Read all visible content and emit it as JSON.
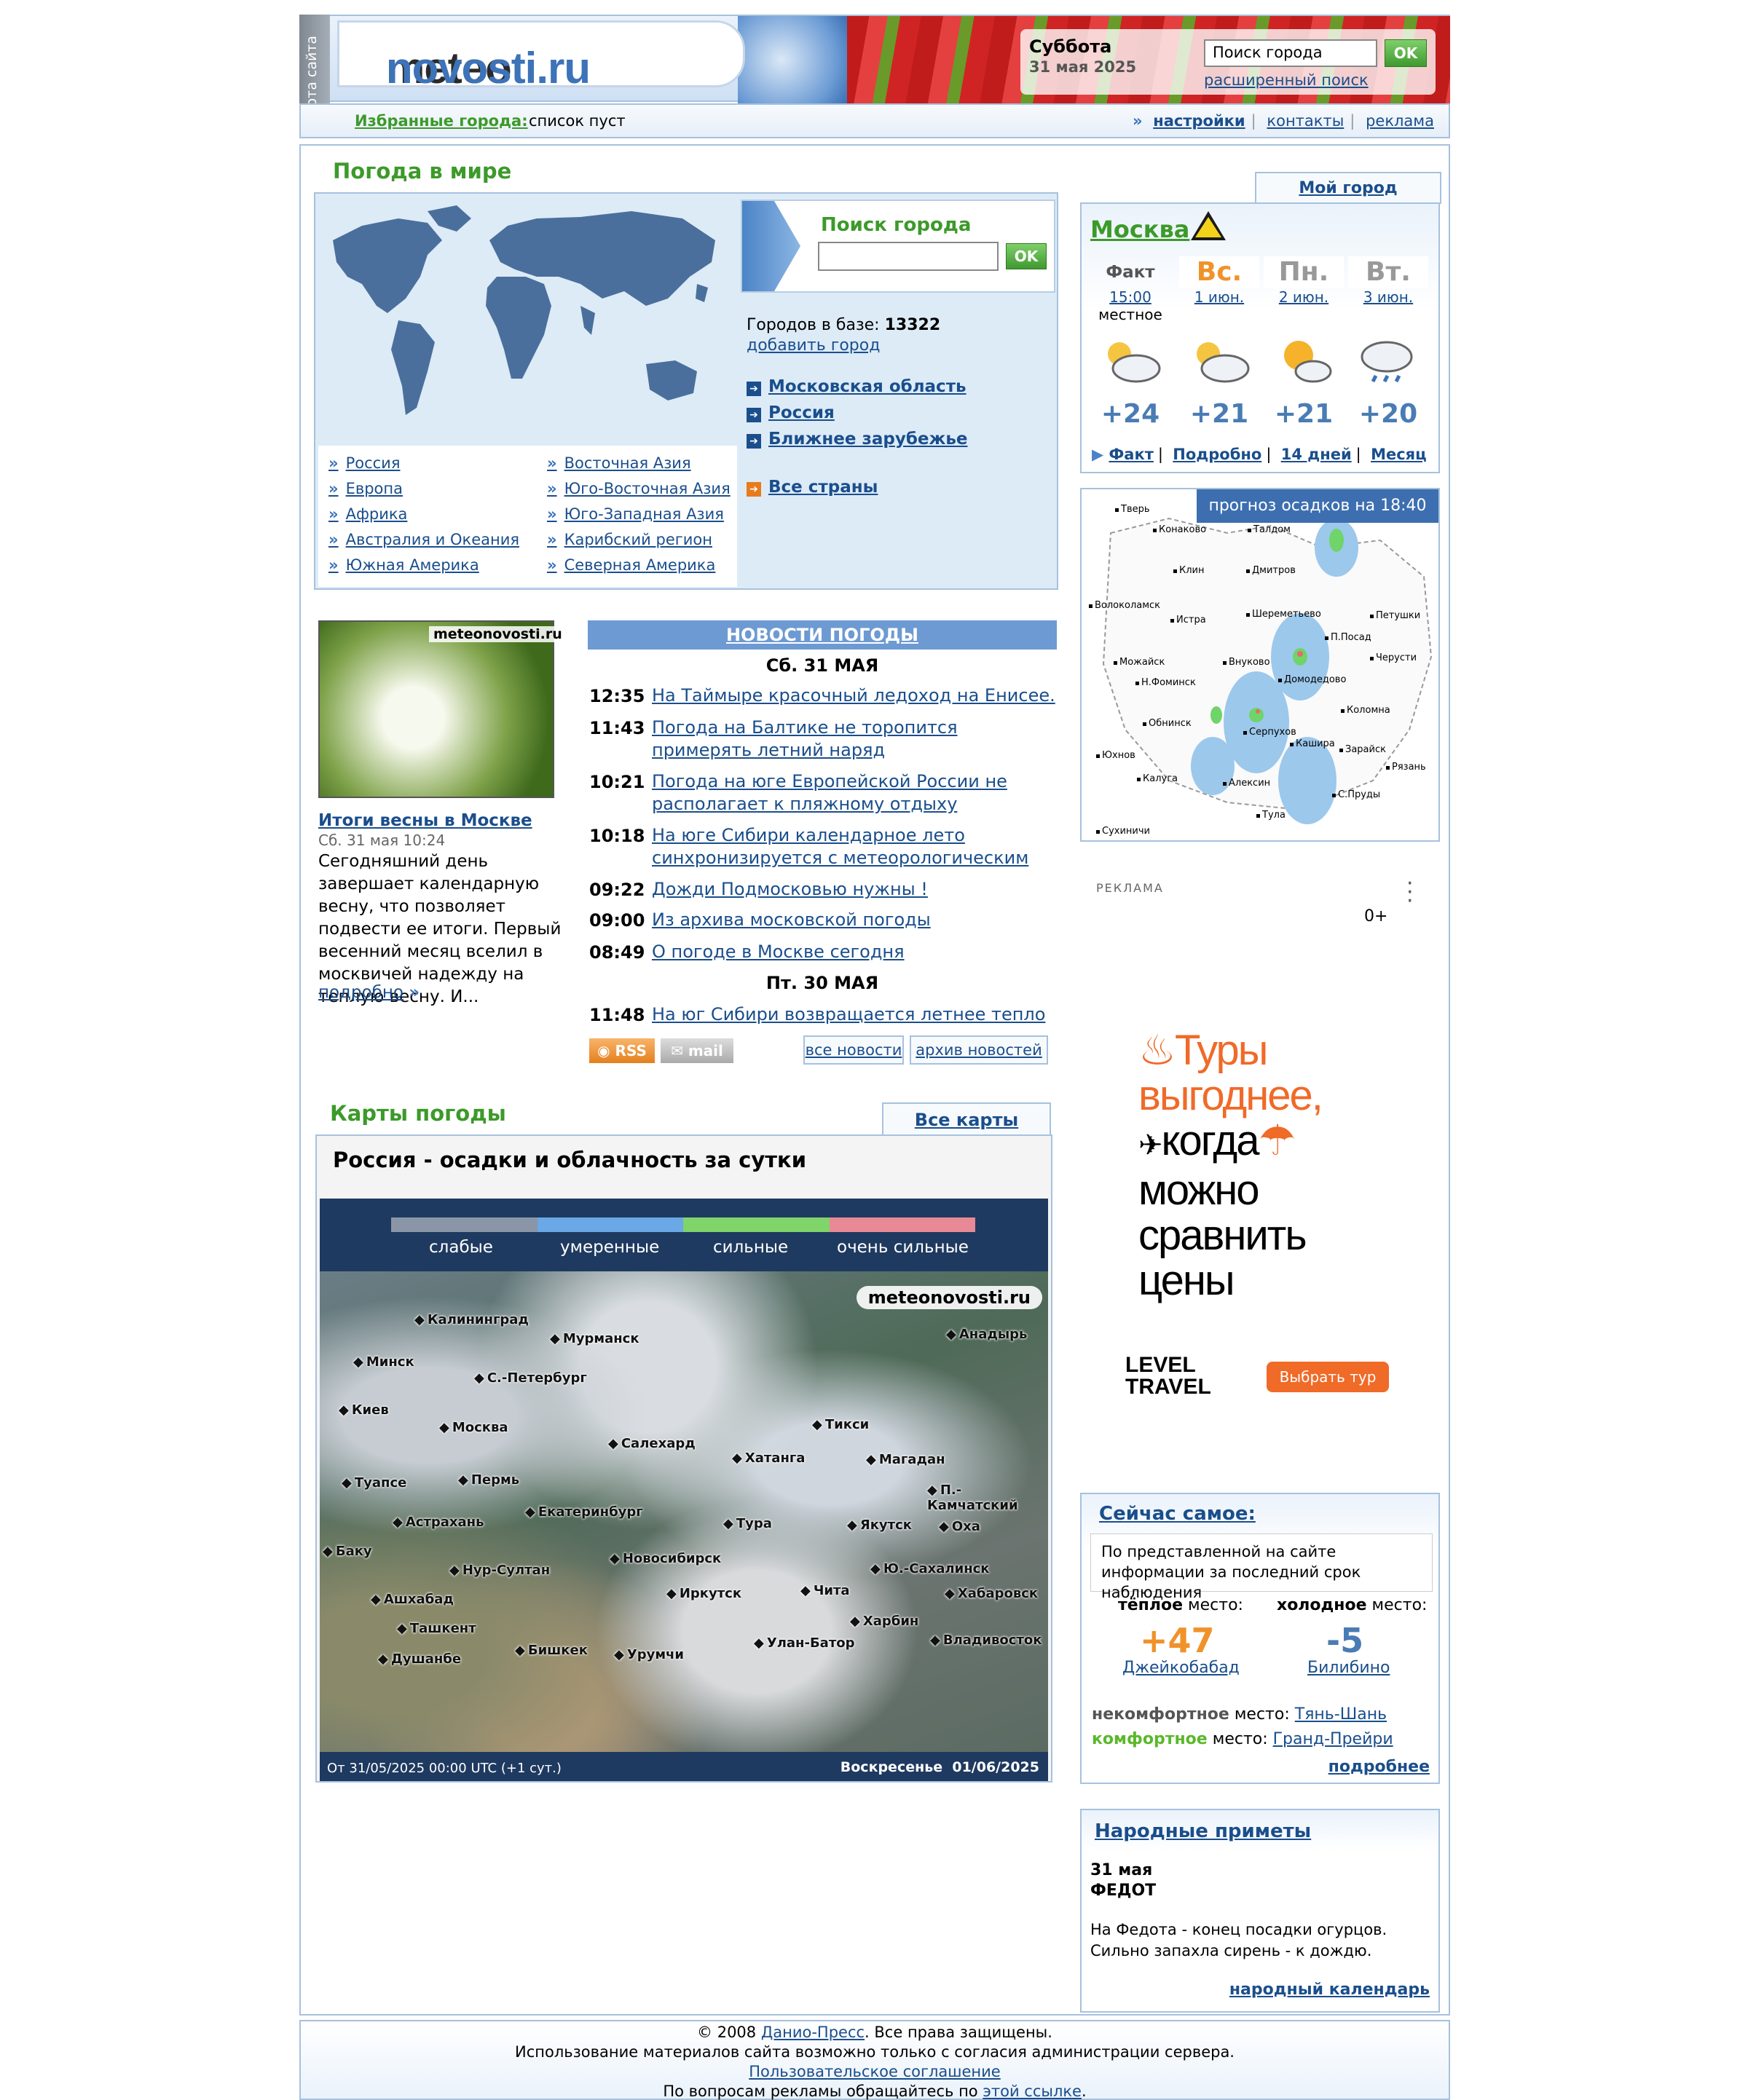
{
  "header": {
    "side_tab": "карта сайта",
    "logo_part1": "meteo",
    "logo_part2": "novosti.ru",
    "day": "Суббота",
    "date": "31 мая 2025",
    "search_value": "Поиск города",
    "search_ok": "OK",
    "advanced_search": "расширенный поиск"
  },
  "favbar": {
    "label": "Избранные города:",
    "value": "список пуст",
    "links": [
      "настройки",
      "контакты",
      "реклама"
    ]
  },
  "world": {
    "title": "Погода в мире",
    "regions_left": [
      "Россия",
      "Европа",
      "Африка",
      "Австралия и Океания",
      "Южная Америка"
    ],
    "regions_right": [
      "Восточная Азия",
      "Юго-Восточная Азия",
      "Юго-Западная Азия",
      "Карибский регион",
      "Северная Америка"
    ],
    "search_title": "Поиск города",
    "search_ok": "OK",
    "cities_label": "Городов в базе:",
    "cities_count": "13322",
    "add_city": "добавить город",
    "links": [
      "Московская область",
      "Россия",
      "Ближнее зарубежье"
    ],
    "all_countries": "Все страны"
  },
  "mycity": {
    "tab": "Мой город",
    "name": "Москва",
    "fact_label": "Факт",
    "fact_time": "15:00",
    "fact_note": "местное",
    "days": [
      {
        "name": "Вс.",
        "date": "1 июн."
      },
      {
        "name": "Пн.",
        "date": "2 июн."
      },
      {
        "name": "Вт.",
        "date": "3 июн."
      }
    ],
    "icons": [
      "partly-cloudy-icon",
      "partly-cloudy-icon",
      "sun-cloud-icon",
      "rain-cloud-icon"
    ],
    "temps": [
      "+24",
      "+21",
      "+21",
      "+20"
    ],
    "links": [
      "Факт",
      "Подробно",
      "14 дней",
      "Месяц"
    ]
  },
  "radar": {
    "title": "прогноз осадков на 18:40",
    "cities": [
      "Тверь",
      "Конаково",
      "Талдом",
      "Клин",
      "Дмитров",
      "Волоколамск",
      "Истра",
      "Шереметьево",
      "Петушки",
      "П.Посад",
      "Можайск",
      "Внуково",
      "Черусти",
      "Н.Фоминск",
      "Домодедово",
      "Обнинск",
      "Коломна",
      "Серпухов",
      "Кашира",
      "Зарайск",
      "Юхнов",
      "Калуга",
      "Алексин",
      "Рязань",
      "С.Пруды",
      "Тула",
      "Сухиничи"
    ]
  },
  "news": {
    "featured": {
      "logo": "meteonovosti.ru",
      "title": "Итоги весны в Москве",
      "date": "Сб. 31 мая 10:24",
      "text": "Сегодняшний день завершает календарную весну, что позволяет подвести ее итоги.      Первый весенний месяц вселил в москвичей надежду на теплую весну. И...",
      "more": "подробно"
    },
    "header": "НОВОСТИ ПОГОДЫ",
    "day1": "Сб. 31 МАЯ",
    "items1": [
      {
        "time": "12:35",
        "title": "На Таймыре красочный ледоход на Енисее."
      },
      {
        "time": "11:43",
        "title": "Погода на Балтике не торопится примерять летний наряд"
      },
      {
        "time": "10:21",
        "title": "Погода на юге Европейской России не располагает к пляжному отдыху"
      },
      {
        "time": "10:18",
        "title": "На юге Сибири календарное лето синхронизируется с метеорологическим"
      },
      {
        "time": "09:22",
        "title": "Дожди Подмосковью нужны !"
      },
      {
        "time": "09:00",
        "title": "Из архива московской погоды"
      },
      {
        "time": "08:49",
        "title": "О погоде в Москве сегодня"
      }
    ],
    "day2": "Пт. 30 МАЯ",
    "items2": [
      {
        "time": "11:48",
        "title": "На юг Сибири возвращается летнее тепло"
      }
    ],
    "rss": "RSS",
    "mail": "mail",
    "all_news": "все новости",
    "archive": "архив новостей"
  },
  "maps": {
    "title": "Карты погоды",
    "all_maps": "Все карты",
    "map_title": "Россия - осадки и облачность за сутки",
    "legend": [
      "слабые",
      "умеренные",
      "сильные",
      "очень сильные"
    ],
    "legend_colors": [
      "#8a96a8",
      "#6aa8e6",
      "#7fd46a",
      "#e88a96"
    ],
    "logo": "meteonovosti.ru",
    "cities": [
      "Калининград",
      "Мурманск",
      "Анадырь",
      "Минск",
      "С.-Петербург",
      "Киев",
      "Москва",
      "Тикси",
      "Салехард",
      "Хатанга",
      "Магадан",
      "Туапсе",
      "Пермь",
      "П.-Камчатский",
      "Екатеринбург",
      "Астрахань",
      "Тура",
      "Якутск",
      "Оха",
      "Баку",
      "Новосибирск",
      "Нур-Султан",
      "Ю.-Сахалинск",
      "Ашхабад",
      "Иркутск",
      "Чита",
      "Хабаровск",
      "Ташкент",
      "Харбин",
      "Улан-Батор",
      "Бишкек",
      "Владивосток",
      "Душанбе",
      "Урумчи"
    ],
    "foot_left": "От 31/05/2025 00:00 UTC (+1 сут.)",
    "foot_right": "Воскресенье  01/06/2025"
  },
  "ad": {
    "label": "РЕКЛАМА",
    "age": "0+",
    "line1": "Туры",
    "line2": "выгоднее,",
    "line3": "когда",
    "line4": "можно",
    "line5": "сравнить",
    "line6": "цены",
    "logo1": "LEVEL",
    "logo2": "TRAVEL",
    "button": "Выбрать тур",
    "accent": "#f06a28"
  },
  "now": {
    "title": "Сейчас самое:",
    "note": "По представленной на сайте информации за последний срок наблюдения",
    "warm_label_b": "тёплое",
    "warm_label": "место:",
    "cold_label_b": "холодное",
    "cold_label": "место:",
    "warm_value": "+47",
    "cold_value": "-5",
    "warm_city": "Джейкобабад",
    "cold_city": "Билибино",
    "uncomf_label_b": "некомфортное",
    "uncomf_label": "место:",
    "uncomf_city": "Тянь-Шань",
    "comf_label_b": "комфортное",
    "comf_label": "место:",
    "comf_city": "Гранд-Прейри",
    "more": "подробнее"
  },
  "folk": {
    "title": "Народные приметы",
    "date": "31 мая",
    "name": "ФЕДОТ",
    "text": "На Федота - конец посадки огурцов. Сильно запахла сирень - к дождю.",
    "more": "народный календарь"
  },
  "footer": {
    "copy1": "© 2008 ",
    "copy_link": "Данио-Пресс",
    "copy2": ". Все права защищены.",
    "line2": "Использование материалов сайта возможно только с согласия администрации сервера.",
    "agreement": "Пользовательское соглашение",
    "ads1": "По вопросам рекламы обращайтесь по ",
    "ads_link": "этой ссылке",
    "ads2": "."
  }
}
